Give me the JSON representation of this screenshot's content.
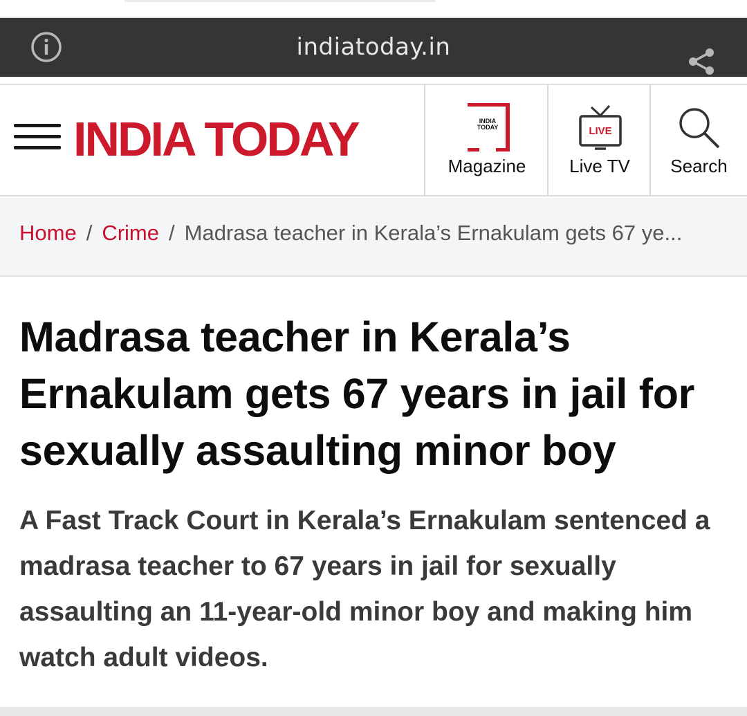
{
  "browser": {
    "domain": "indiatoday.in",
    "info_icon": "info-circle-icon",
    "share_icon": "share-icon"
  },
  "header": {
    "logo_text": "INDIA TODAY",
    "nav": [
      {
        "label": "Magazine",
        "icon": "magazine-icon",
        "icon_text_line1": "INDIA",
        "icon_text_line2": "TODAY"
      },
      {
        "label": "Live TV",
        "icon": "live-tv-icon",
        "icon_text": "LIVE"
      },
      {
        "label": "Search",
        "icon": "search-icon"
      }
    ]
  },
  "breadcrumb": {
    "items": [
      "Home",
      "Crime"
    ],
    "separator": "/",
    "current": "Madrasa teacher in Kerala’s Ernakulam gets 67 ye..."
  },
  "article": {
    "headline": "Madrasa teacher in Kerala’s Ernakulam gets 67 years in jail for sexually assaulting minor boy",
    "summary": "A Fast Track Court in Kerala’s Ernakulam sentenced a madrasa teacher to 67 years in jail for sexually assaulting an 11-year-old minor boy and making him watch adult videos."
  },
  "colors": {
    "brand": "#cc1a2c",
    "urlbar_bg": "#343536",
    "breadcrumb_bg": "#f4f5f7"
  }
}
